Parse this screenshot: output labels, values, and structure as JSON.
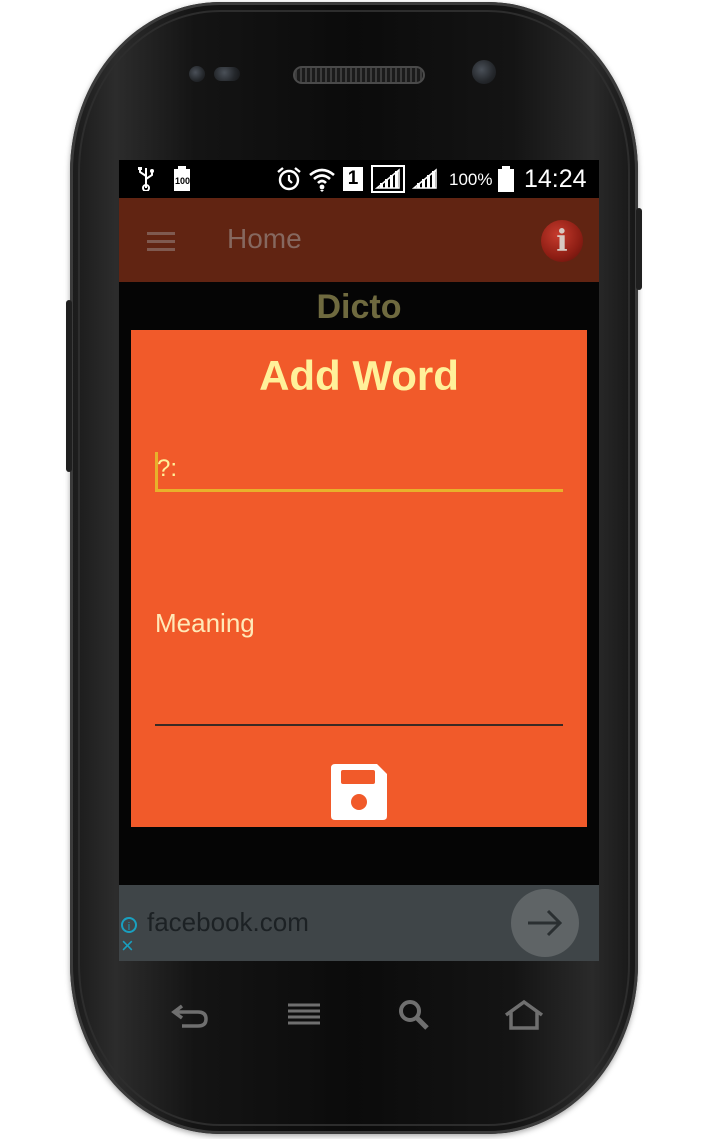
{
  "status_bar": {
    "battery_level_icon_text": "100",
    "battery_percent": "100%",
    "sim_label": "1",
    "time": "14:24"
  },
  "toolbar": {
    "title": "Home"
  },
  "app": {
    "heading": "Dicto"
  },
  "dialog": {
    "title": "Add Word",
    "word_placeholder": "?:",
    "meaning_placeholder": "Meaning"
  },
  "ad": {
    "url": "facebook.com"
  },
  "colors": {
    "toolbar": "#612412",
    "dialog_bg": "#f15a2a",
    "dialog_title": "#fff19a",
    "input_underline": "#e8b12b"
  },
  "icons": {
    "status": [
      "usb-icon",
      "battery-saver-icon",
      "alarm-icon",
      "wifi-icon",
      "sim-icon",
      "signal-icon",
      "signal-icon",
      "battery-icon"
    ],
    "toolbar": [
      "menu-icon",
      "info-icon"
    ],
    "dialog": [
      "save-icon"
    ],
    "ad": [
      "ad-info-icon",
      "close-icon",
      "arrow-right-icon"
    ],
    "navigation": [
      "back-icon",
      "menu-lines-icon",
      "search-icon",
      "home-icon"
    ]
  }
}
